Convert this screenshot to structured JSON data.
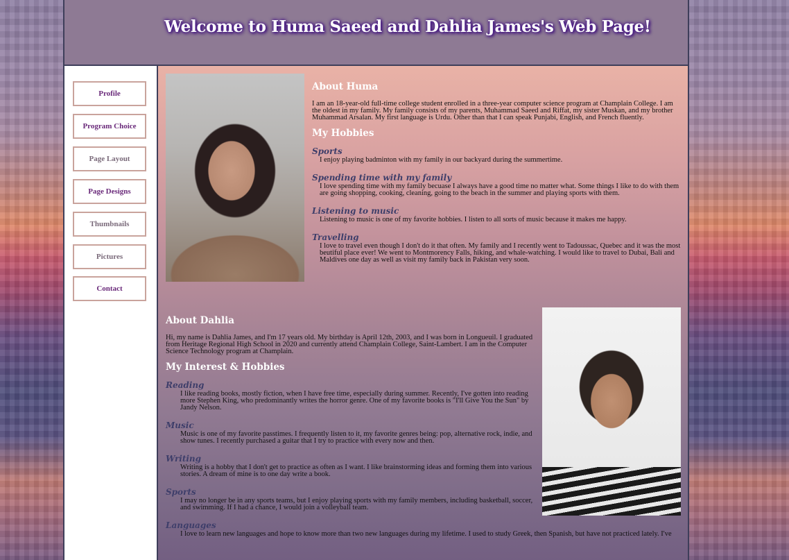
{
  "header": {
    "title": "Welcome to Huma Saeed and Dahlia James's Web Page!"
  },
  "nav": {
    "items": [
      {
        "label": "Profile"
      },
      {
        "label": "Program Choice"
      },
      {
        "label": "Page Layout"
      },
      {
        "label": "Page Designs"
      },
      {
        "label": "Thumbnails"
      },
      {
        "label": "Pictures"
      },
      {
        "label": "Contact"
      }
    ]
  },
  "huma": {
    "about_heading": "About Huma",
    "about_text": "I am an 18-year-old full-time college student enrolled in a three-year computer science program at Champlain College. I am the oldest in my family. My family consists of my parents, Muhammad Saeed and Riffat, my sister Muskan, and my brother Muhammad Arsalan. My first language is Urdu. Other than that I can speak Punjabi, English, and French fluently.",
    "hobbies_heading": "My Hobbies",
    "hobbies": [
      {
        "title": "Sports",
        "text": "I enjoy playing badminton with my family in our backyard during the summertime."
      },
      {
        "title": "Spending time with my family",
        "text": "I love spending time with my family becuase I always have a good time no matter what. Some things I like to do with them are going shopping, cooking, cleaning, going to the beach in the summer and playing sports with them."
      },
      {
        "title": "Listening to music",
        "text": "Listening to music is one of my favorite hobbies. I listen to all sorts of music because it makes me happy."
      },
      {
        "title": "Travelling",
        "text": "I love to travel even though I don't do it that often. My family and I recently went to Tadoussac, Quebec and it was the most beutiful place ever! We went to Montmorency Falls, hiking, and whale-watching. I would like to travel to Dubai, Bali and Maldives one day as well as visit my family back in Pakistan very soon."
      }
    ]
  },
  "dahlia": {
    "about_heading": "About Dahlia",
    "about_text": "Hi, my name is Dahlia James, and I'm 17 years old. My birthday is April 12th, 2003, and I was born in Longueuil. I graduated from Heritage Regional High School in 2020 and currently attend Champlain College, Saint-Lambert. I am in the Computer Science Technology program at Champlain.",
    "hobbies_heading": "My Interest & Hobbies",
    "hobbies": [
      {
        "title": "Reading",
        "text": "I like reading books, mostly fiction, when I have free time, especially during summer. Recently, I've gotten into reading more Stephen King, who predominantly writes the horror genre. One of my favorite books is \"I'll Give You the Sun\" by Jandy Nelson."
      },
      {
        "title": "Music",
        "text": "Music is one of my favorite passtimes. I frequently listen to it, my favorite genres being: pop, alternative rock, indie, and show tunes. I recently purchased a guitar that I try to practice with every now and then."
      },
      {
        "title": "Writing",
        "text": "Writing is a hobby that I don't get to practice as often as I want. I like brainstorming ideas and forming them into various stories. A dream of mine is to one day write a book."
      },
      {
        "title": "Sports",
        "text": "I may no longer be in any sports teams, but I enjoy playing sports with my family members, including basketball, soccer, and swimming. If I had a chance, I would join a volleyball team."
      },
      {
        "title": "Languages",
        "text": "I love to learn new languages and hope to know more than two new languages during my lifetime. I used to study Greek, then Spanish, but have not practiced lately. I've"
      }
    ]
  }
}
